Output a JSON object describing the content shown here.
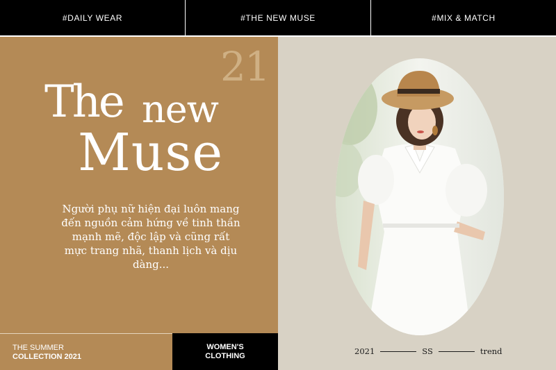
{
  "top_bar": {
    "tags": [
      "#DAILY WEAR",
      "#THE NEW MUSE",
      "#MIX & MATCH"
    ]
  },
  "hero": {
    "year": "21",
    "title_line1_a": "The",
    "title_line1_b": "new",
    "title_line2": "Muse",
    "description": "Người phụ nữ hiện đại luôn mang đến nguồn cảm hứng về tinh thần mạnh mẽ, độc lập và cũng rất mực trang nhã, thanh lịch và dịu dàng..."
  },
  "collection": {
    "line1": "THE SUMMER",
    "line2": "COLLECTION 2021"
  },
  "category": {
    "line1": "WOMEN'S",
    "line2": "CLOTHING"
  },
  "trend": {
    "year": "2021",
    "season": "SS",
    "label": "trend"
  },
  "colors": {
    "accent": "#b48a56",
    "background": "#d8d2c5",
    "bar": "#000000",
    "text_light": "#ffffff"
  }
}
